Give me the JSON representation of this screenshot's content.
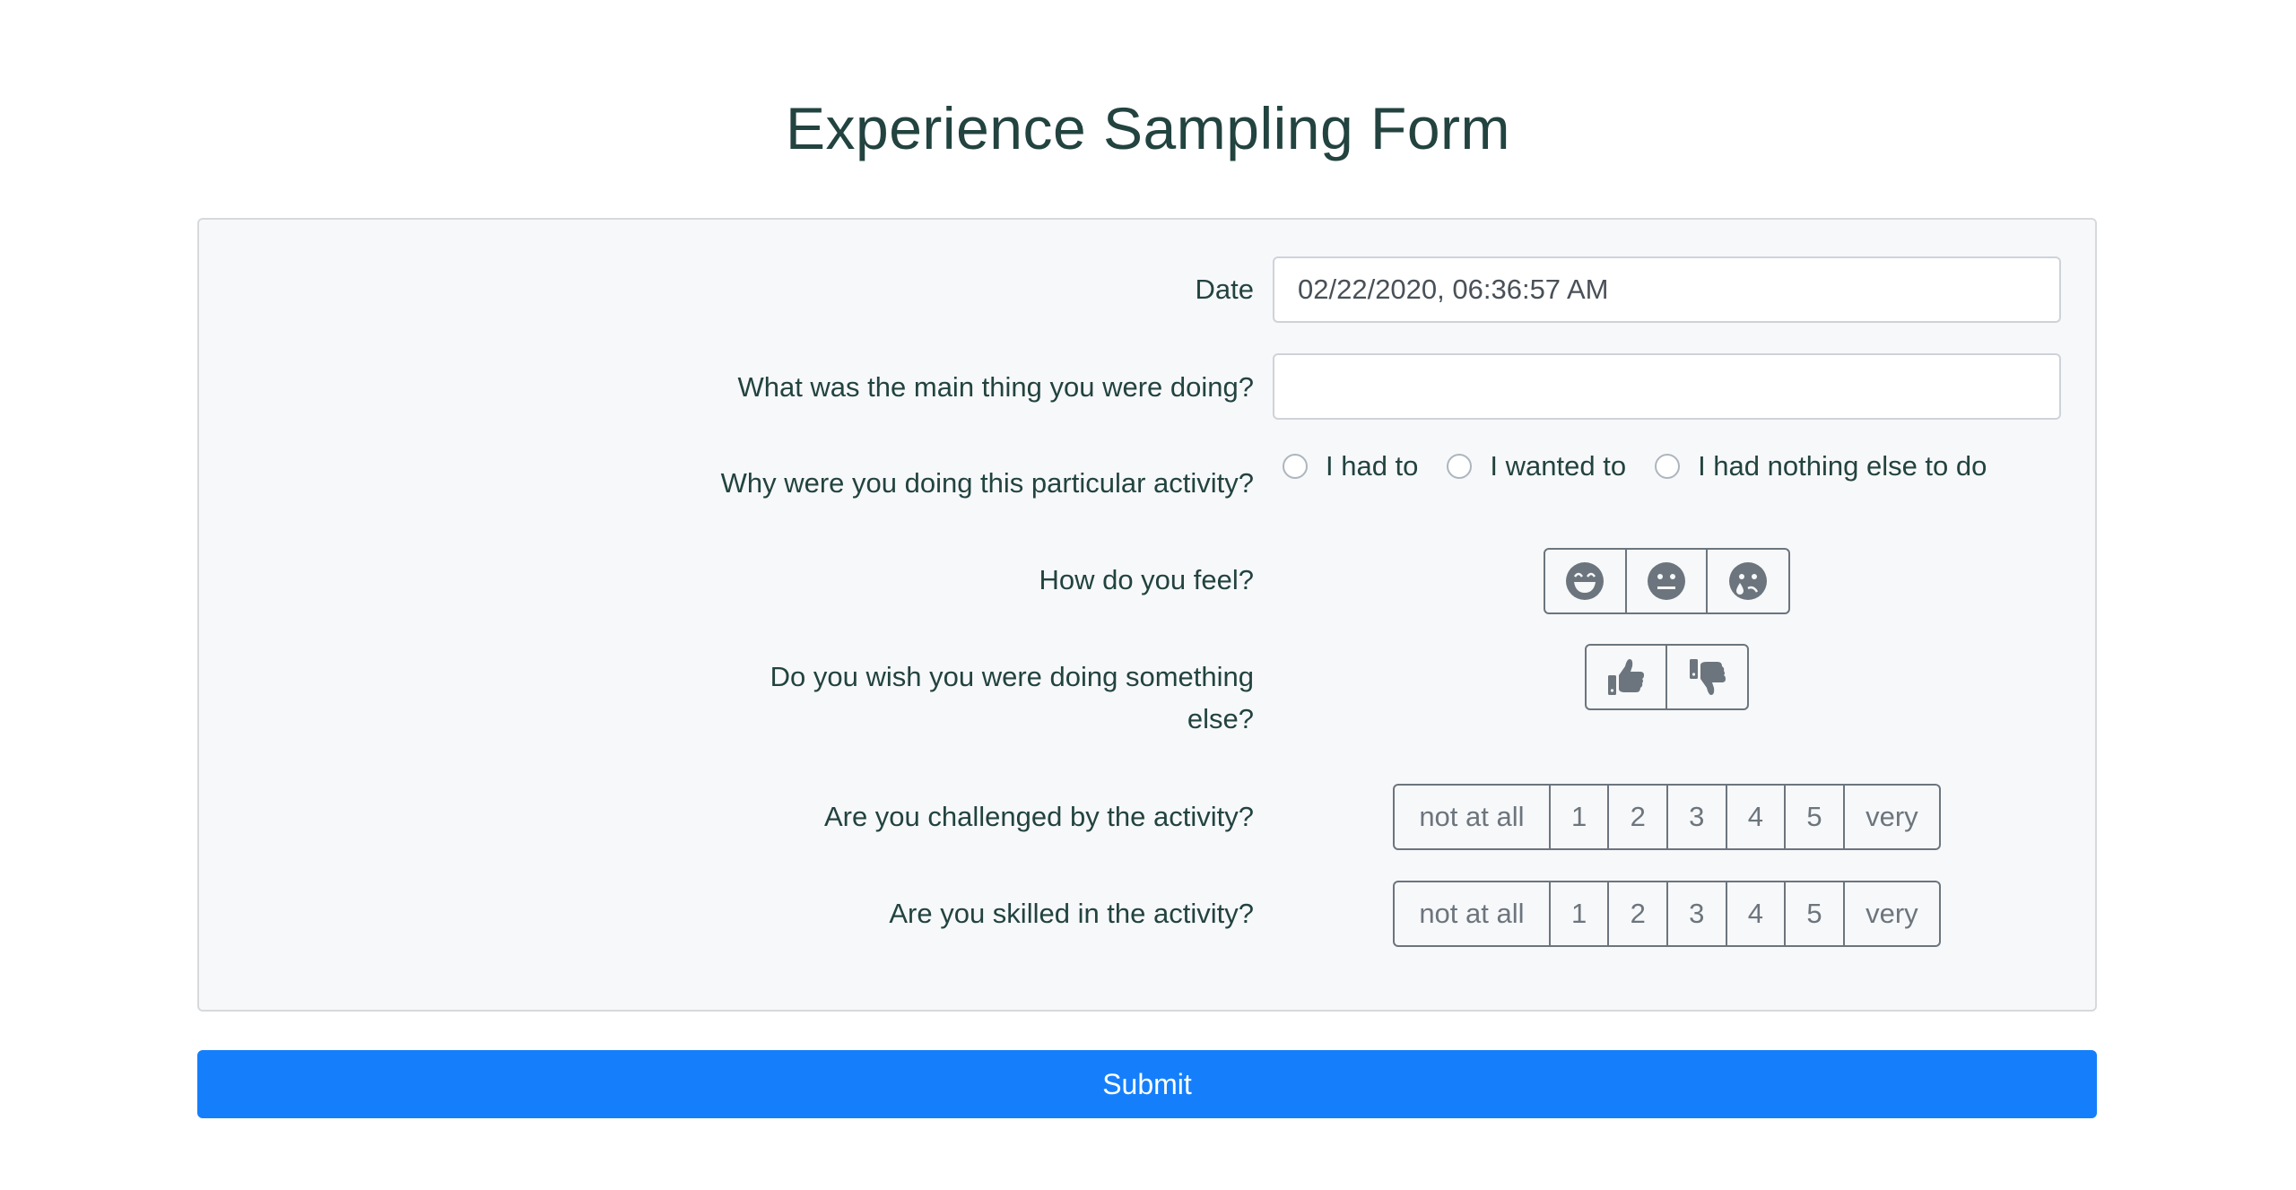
{
  "page": {
    "title": "Experience Sampling Form"
  },
  "form": {
    "date": {
      "label": "Date",
      "value": "02/22/2020, 06:36:57 AM"
    },
    "activity": {
      "label": "What was the main thing you were doing?",
      "value": "",
      "placeholder": ""
    },
    "reason": {
      "label": "Why were you doing this particular activity?",
      "options": [
        "I had to",
        "I wanted to",
        "I had nothing else to do"
      ],
      "selected": null
    },
    "feeling": {
      "label": "How do you feel?",
      "options": [
        {
          "icon": "grin-beam-icon",
          "value": "happy"
        },
        {
          "icon": "meh-icon",
          "value": "neutral"
        },
        {
          "icon": "sad-tear-icon",
          "value": "sad"
        }
      ]
    },
    "wish_else": {
      "label": "Do you wish you were doing something else?",
      "options": [
        {
          "icon": "thumbs-up-icon",
          "value": "yes"
        },
        {
          "icon": "thumbs-down-icon",
          "value": "no"
        }
      ]
    },
    "challenged": {
      "label": "Are you challenged by the activity?",
      "scale": [
        "not at all",
        "1",
        "2",
        "3",
        "4",
        "5",
        "very"
      ]
    },
    "skilled": {
      "label": "Are you skilled in the activity?",
      "scale": [
        "not at all",
        "1",
        "2",
        "3",
        "4",
        "5",
        "very"
      ]
    }
  },
  "submit": {
    "label": "Submit"
  },
  "colors": {
    "accent": "#157ffb",
    "text": "#22433f",
    "muted": "#6c757d",
    "panel": "#f7f8fa"
  }
}
